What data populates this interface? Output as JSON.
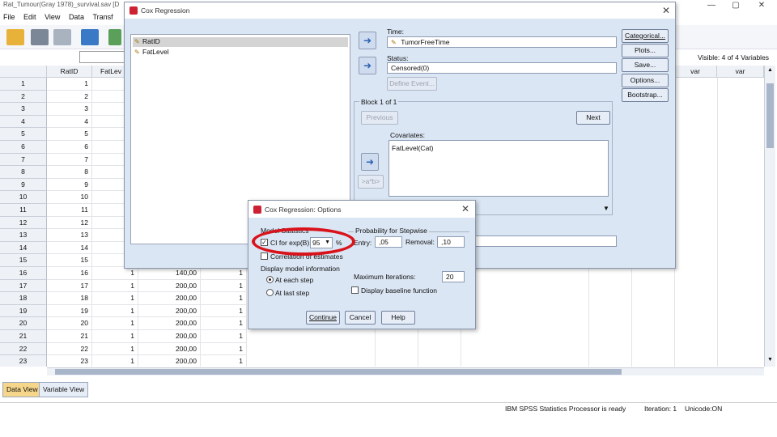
{
  "window": {
    "title": "Rat_Tumour(Gray 1978)_survival.sav [D",
    "controls": [
      "—",
      "▢",
      "✕"
    ]
  },
  "menubar": [
    "File",
    "Edit",
    "View",
    "Data",
    "Transf"
  ],
  "grid": {
    "headers": [
      "RatID",
      "FatLev",
      "var",
      "var"
    ],
    "rows": [
      {
        "n": "1",
        "ratid": "1"
      },
      {
        "n": "2",
        "ratid": "2"
      },
      {
        "n": "3",
        "ratid": "3"
      },
      {
        "n": "4",
        "ratid": "4"
      },
      {
        "n": "5",
        "ratid": "5"
      },
      {
        "n": "6",
        "ratid": "6"
      },
      {
        "n": "7",
        "ratid": "7"
      },
      {
        "n": "8",
        "ratid": "8"
      },
      {
        "n": "9",
        "ratid": "9"
      },
      {
        "n": "10",
        "ratid": "10"
      },
      {
        "n": "11",
        "ratid": "11"
      },
      {
        "n": "12",
        "ratid": "12"
      },
      {
        "n": "13",
        "ratid": "13"
      },
      {
        "n": "14",
        "ratid": "14"
      },
      {
        "n": "15",
        "ratid": "15"
      },
      {
        "n": "16",
        "ratid": "16",
        "fat": "1",
        "time": "140,00",
        "status": "1"
      },
      {
        "n": "17",
        "ratid": "17",
        "fat": "1",
        "time": "200,00",
        "status": "1"
      },
      {
        "n": "18",
        "ratid": "18",
        "fat": "1",
        "time": "200,00",
        "status": "1"
      },
      {
        "n": "19",
        "ratid": "19",
        "fat": "1",
        "time": "200,00",
        "status": "1"
      },
      {
        "n": "20",
        "ratid": "20",
        "fat": "1",
        "time": "200,00",
        "status": "1"
      },
      {
        "n": "21",
        "ratid": "21",
        "fat": "1",
        "time": "200,00",
        "status": "1"
      },
      {
        "n": "22",
        "ratid": "22",
        "fat": "1",
        "time": "200,00",
        "status": "1"
      },
      {
        "n": "23",
        "ratid": "23",
        "fat": "1",
        "time": "200,00",
        "status": "1"
      }
    ]
  },
  "visible_label": "Visible: 4 of 4 Variables",
  "tabs": [
    "Data View",
    "Variable View"
  ],
  "statusbar": {
    "processor": "IBM SPSS Statistics Processor is ready",
    "iteration": "Iteration: 1",
    "unicode": "Unicode:ON"
  },
  "cox": {
    "title": "Cox Regression",
    "variables": [
      "RatID",
      "FatLevel"
    ],
    "time_label": "Time:",
    "time_value": "TumorFreeTime",
    "status_label": "Status:",
    "status_value": "Censored(0)",
    "define_event": "Define Event...",
    "block_label": "Block 1 of 1",
    "previous": "Previous",
    "next": "Next",
    "covariates_label": "Covariates:",
    "covariates": [
      "FatLevel(Cat)"
    ],
    "ab_button": ">a*b>",
    "side_buttons": [
      "Categorical...",
      "Plots...",
      "Save...",
      "Options...",
      "Bootstrap..."
    ]
  },
  "options": {
    "title": "Cox Regression: Options",
    "model_stats_label": "Model Statistics",
    "ci_label": "CI for exp(B):",
    "ci_value": "95",
    "percent": "%",
    "corr_label": "Correlation of estimates",
    "display_label": "Display model information",
    "radio_each": "At each step",
    "radio_last": "At last step",
    "stepwise_label": "Probability for Stepwise",
    "entry_label": "Entry:",
    "entry_value": ",05",
    "removal_label": "Removal:",
    "removal_value": ",10",
    "maxiter_label": "Maximum Iterations:",
    "maxiter_value": "20",
    "baseline_label": "Display baseline function",
    "continue": "Continue",
    "cancel": "Cancel",
    "help": "Help"
  },
  "colors": {
    "highlight": "#d9131b",
    "dialog_bg": "#dbe6f4",
    "accent": "#2a62b5"
  }
}
